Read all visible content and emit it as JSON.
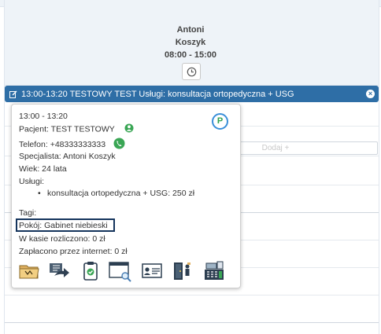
{
  "column": {
    "name": "Antoni",
    "surname": "Koszyk",
    "hours": "08:00 - 15:00"
  },
  "event": {
    "label": "13:00-13:20 TESTOWY TEST Usługi: konsultacja ortopedyczna + USG",
    "close_symbol": "×"
  },
  "add_slot": {
    "label": "Dodaj +"
  },
  "popup": {
    "time": "13:00 - 13:20",
    "patient": "Pacjent: TEST TESTOWY",
    "phone": "Telefon: +48333333333",
    "specialist": "Specjalista: Antoni Koszyk",
    "age": "Wiek: 24 lata",
    "services_label": "Usługi:",
    "services": [
      "konsultacja ortopedyczna + USG: 250 zł"
    ],
    "tags": "Tagi:",
    "room": "Pokój: Gabinet niebieski",
    "paid_cash": "W kasie rozliczono: 0 zł",
    "paid_online": "Zapłacono przez internet: 0 zł",
    "badge": "P",
    "action_icons": [
      "folder-icon",
      "forward-arrow-icon",
      "clipboard-check-icon",
      "browser-search-icon",
      "id-card-icon",
      "door-person-icon",
      "cash-register-icon"
    ]
  },
  "colors": {
    "event_bar": "#2e6ea6",
    "badge_ring": "#3a8fd9",
    "badge_text": "#2ea050",
    "room_highlight": "#14345c",
    "header_bg": "#eef3f8"
  }
}
